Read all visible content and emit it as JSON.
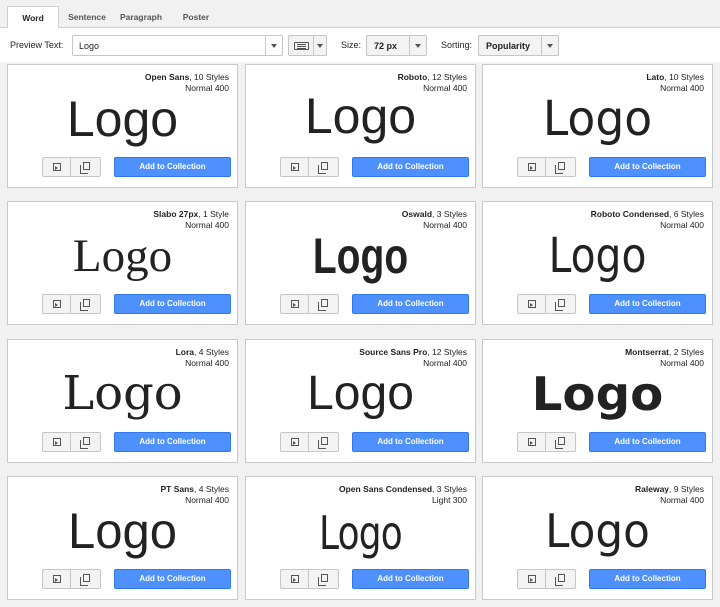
{
  "tabs": [
    {
      "label": "Word",
      "active": true
    },
    {
      "label": "Sentence",
      "active": false
    },
    {
      "label": "Paragraph",
      "active": false
    },
    {
      "label": "Poster",
      "active": false
    }
  ],
  "toolbar": {
    "preview_label": "Preview Text:",
    "preview_value": "Logo",
    "size_label": "Size:",
    "size_value": "72 px",
    "sorting_label": "Sorting:",
    "sorting_value": "Popularity"
  },
  "card_actions": {
    "add_label": "Add to Collection"
  },
  "colors": {
    "accent": "#4d90fe",
    "border": "#c9c9c9"
  },
  "fonts": [
    {
      "name": "Open Sans",
      "styles": ", 10 Styles",
      "variant": "Normal 400",
      "sample": "Logo"
    },
    {
      "name": "Roboto",
      "styles": ", 12 Styles",
      "variant": "Normal 400",
      "sample": "Logo"
    },
    {
      "name": "Lato",
      "styles": ", 10 Styles",
      "variant": "Normal 400",
      "sample": "Logo"
    },
    {
      "name": "Slabo 27px",
      "styles": ", 1 Style",
      "variant": "Normal 400",
      "sample": "Logo"
    },
    {
      "name": "Oswald",
      "styles": ", 3 Styles",
      "variant": "Normal 400",
      "sample": "Logo"
    },
    {
      "name": "Roboto Condensed",
      "styles": ", 6 Styles",
      "variant": "Normal 400",
      "sample": "Logo"
    },
    {
      "name": "Lora",
      "styles": ", 4 Styles",
      "variant": "Normal 400",
      "sample": "Logo"
    },
    {
      "name": "Source Sans Pro",
      "styles": ", 12 Styles",
      "variant": "Normal 400",
      "sample": "Logo"
    },
    {
      "name": "Montserrat",
      "styles": ", 2 Styles",
      "variant": "Normal 400",
      "sample": "Logo"
    },
    {
      "name": "PT Sans",
      "styles": ", 4 Styles",
      "variant": "Normal 400",
      "sample": "Logo"
    },
    {
      "name": "Open Sans Condensed",
      "styles": ", 3 Styles",
      "variant": "Light 300",
      "sample": "Logo"
    },
    {
      "name": "Raleway",
      "styles": ", 9 Styles",
      "variant": "Normal 400",
      "sample": "Logo"
    }
  ]
}
